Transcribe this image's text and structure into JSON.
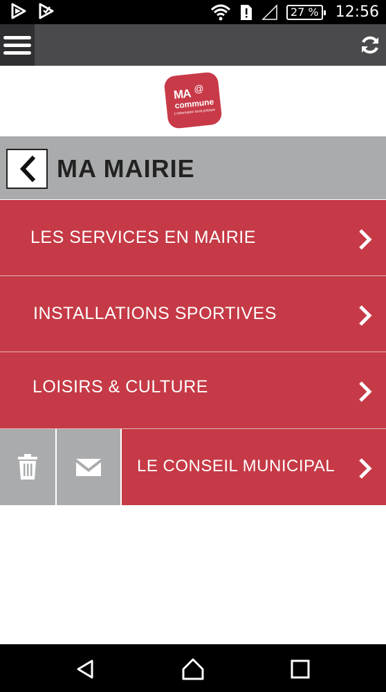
{
  "status_bar": {
    "battery": "27 %",
    "time": "12:56",
    "icons": [
      "play-store-icon",
      "notification-icon",
      "wifi-icon",
      "sim-alert-icon",
      "signal-icon",
      "battery-icon"
    ]
  },
  "app_bar": {
    "menu_icon": "hamburger-menu-icon",
    "refresh_icon": "refresh-icon",
    "background": "#4a4a4c"
  },
  "logo": {
    "line1": "MA",
    "at": "@",
    "line2": "commune",
    "tagline": "L'information local pratique",
    "color": "#c83a48"
  },
  "title_bar": {
    "back_icon": "chevron-left-icon",
    "title": "MA MAIRIE"
  },
  "menu": {
    "items": [
      {
        "label": "LES SERVICES EN MAIRIE"
      },
      {
        "label": "INSTALLATIONS SPORTIVES"
      },
      {
        "label": "LOISIRS & CULTURE"
      },
      {
        "label": "LE CONSEIL MUNICIPAL"
      }
    ],
    "accent": "#c53a46",
    "swipe_actions": [
      "trash-icon",
      "mail-icon"
    ]
  },
  "nav_bar": {
    "buttons": [
      "back-triangle-icon",
      "home-icon",
      "recents-square-icon"
    ]
  }
}
